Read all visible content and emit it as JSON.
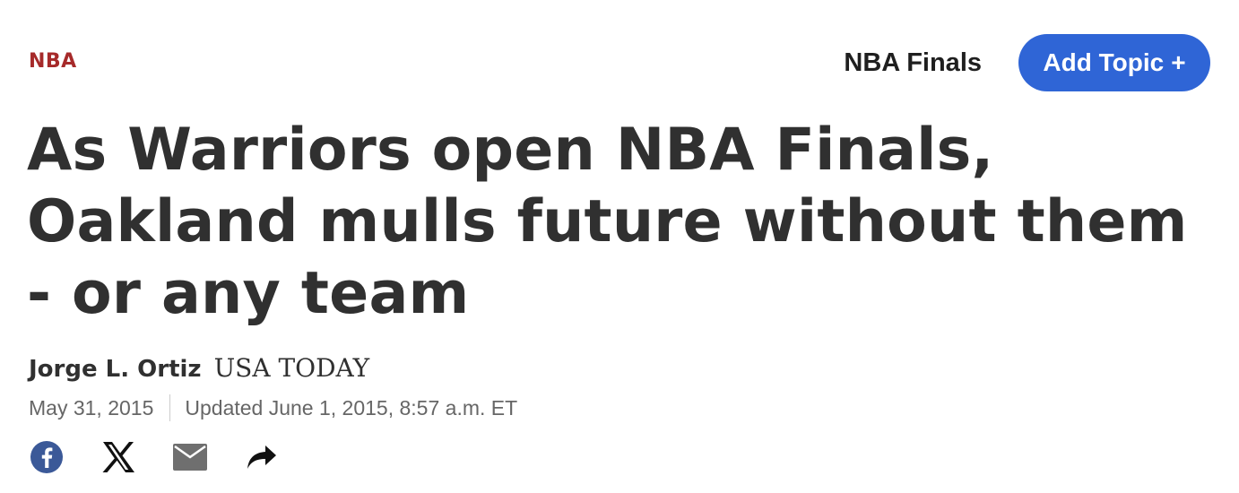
{
  "header": {
    "section_label": "NBA",
    "topic_name": "NBA Finals",
    "add_topic_label": "Add Topic",
    "add_topic_icon": "+"
  },
  "article": {
    "headline": "As Warriors open NBA Finals, Oakland mulls future without them - or any team",
    "author": "Jorge L. Ortiz",
    "publication": "USA TODAY",
    "published_date": "May 31, 2015",
    "updated_text": "Updated June 1, 2015, 8:57 a.m. ET"
  },
  "share": {
    "icons": [
      "facebook-icon",
      "x-icon",
      "email-icon",
      "share-forward-icon"
    ]
  },
  "colors": {
    "section_label": "#a62a2a",
    "button_bg": "#2f65d6",
    "facebook": "#3b5998",
    "text": "#303030",
    "muted": "#666666"
  }
}
